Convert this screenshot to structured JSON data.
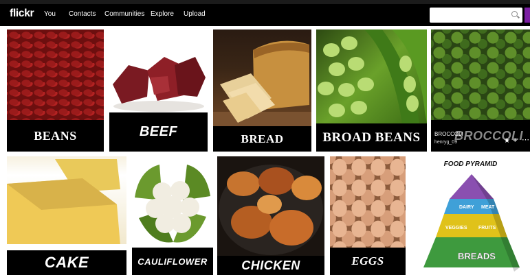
{
  "header": {
    "logo": "flickr",
    "nav": [
      "You",
      "Contacts",
      "Communities",
      "Explore",
      "Upload"
    ],
    "search_placeholder": ""
  },
  "tiles": [
    {
      "caption": "BEANS"
    },
    {
      "caption": "BEEF"
    },
    {
      "caption": "BREAD"
    },
    {
      "caption": "BROAD BEANS"
    },
    {
      "caption": "BROCCOLI",
      "hover_title": "BROCCOLI",
      "hover_owner": "henryg_09"
    },
    {
      "caption": "CAKE"
    },
    {
      "caption": "CAULIFLOWER"
    },
    {
      "caption": "CHICKEN"
    },
    {
      "caption": "EGGS"
    },
    {
      "caption": "FOOD PYRAMID",
      "pyramid_labels": [
        "DAIRY",
        "MEAT",
        "VEGGIES",
        "FRUITS",
        "BREADS"
      ]
    }
  ],
  "icons": [
    "search-icon",
    "star-icon",
    "add-icon",
    "more-icon"
  ]
}
